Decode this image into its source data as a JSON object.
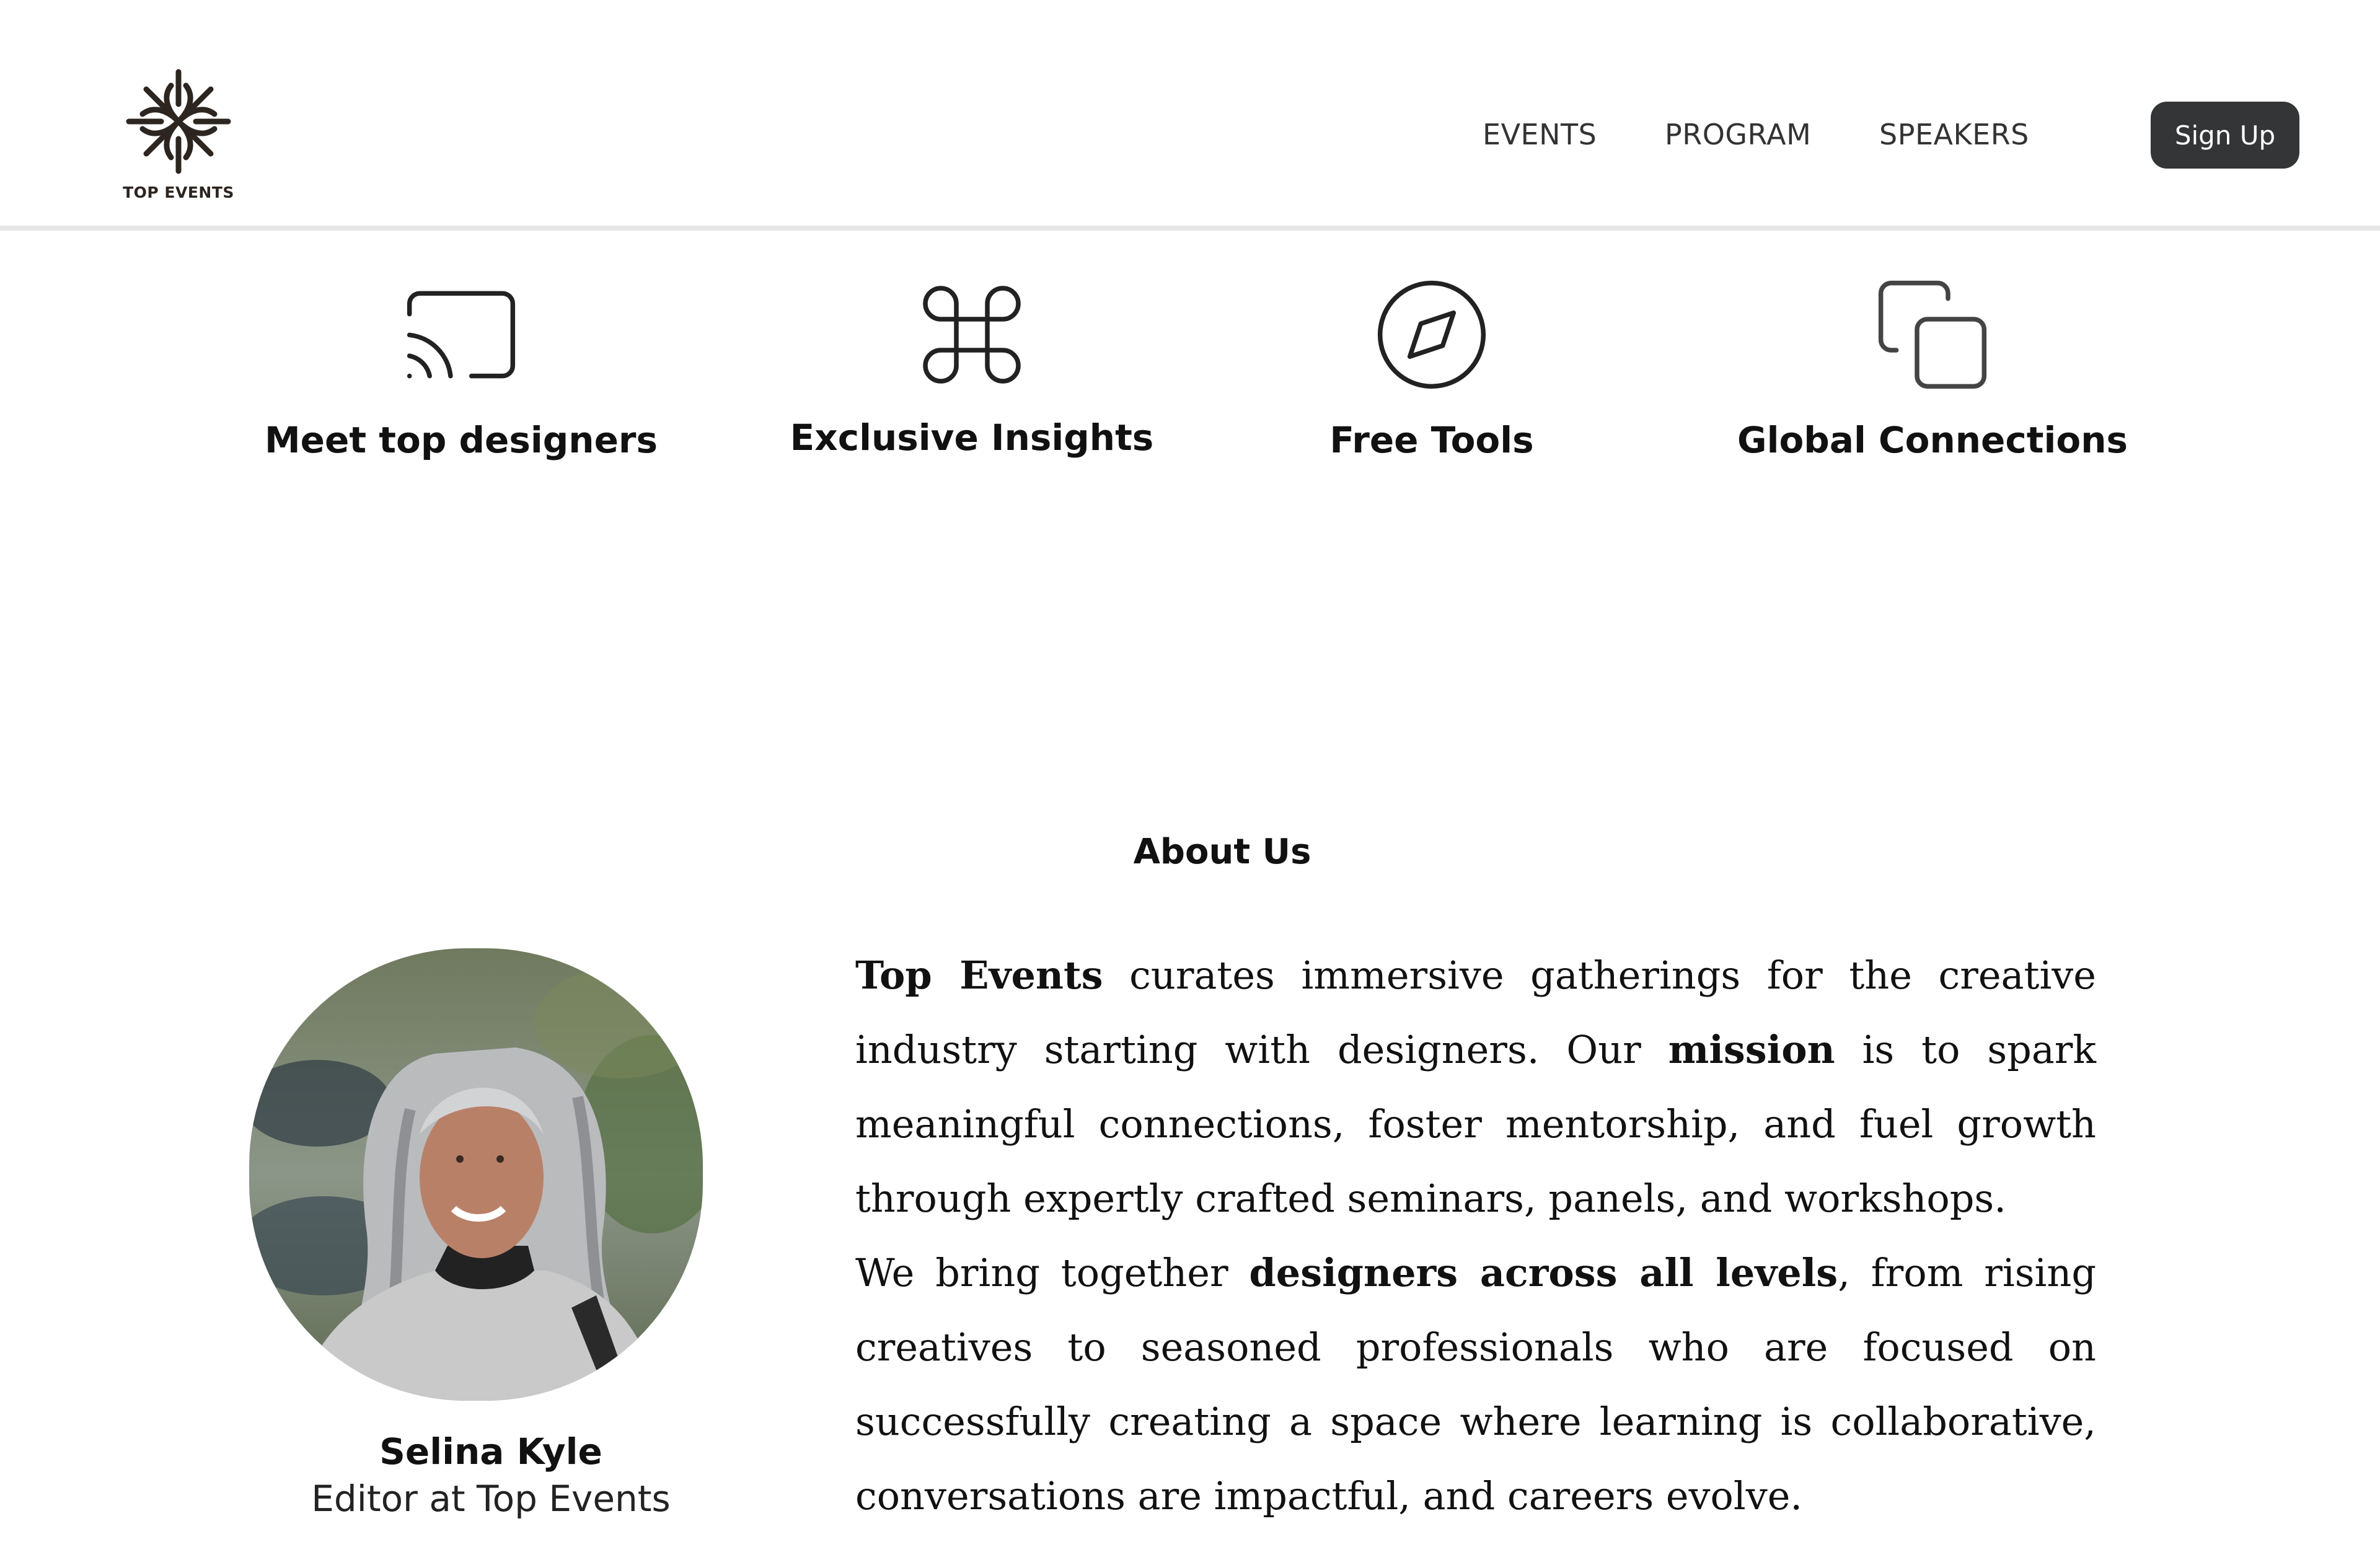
{
  "brand": {
    "name": "TOP EVENTS",
    "logo_icon": "snowflake-ornament-icon"
  },
  "nav": {
    "links": [
      "EVENTS",
      "PROGRAM",
      "SPEAKERS"
    ],
    "signup_label": "Sign Up"
  },
  "features": [
    {
      "icon": "cast-icon",
      "label": "Meet top designers"
    },
    {
      "icon": "command-icon",
      "label": "Exclusive Insights"
    },
    {
      "icon": "compass-icon",
      "label": "Free Tools"
    },
    {
      "icon": "copy-icon",
      "label": "Global Connections"
    }
  ],
  "about": {
    "title": "About Us",
    "p1": {
      "lead_bold": "Top Events",
      "t1": " curates immersive gatherings for the creative industry starting with designers. Our ",
      "bold2": "mission",
      "t2": " is to spark meaningful connections, foster mentorship, and fuel growth through expertly crafted seminars, panels, and workshops."
    },
    "p2": {
      "t1": "We bring together ",
      "bold1": "designers across all levels",
      "t2": ", from rising creatives to seasoned professionals who are focused on successfully creating a space where learning is collaborative, conversations are impactful, and careers evolve."
    }
  },
  "person": {
    "name": "Selina Kyle",
    "role": "Editor at Top Events"
  },
  "colors": {
    "button_bg": "#333536",
    "divider": "#e6e6e6",
    "logo": "#2d2520"
  }
}
